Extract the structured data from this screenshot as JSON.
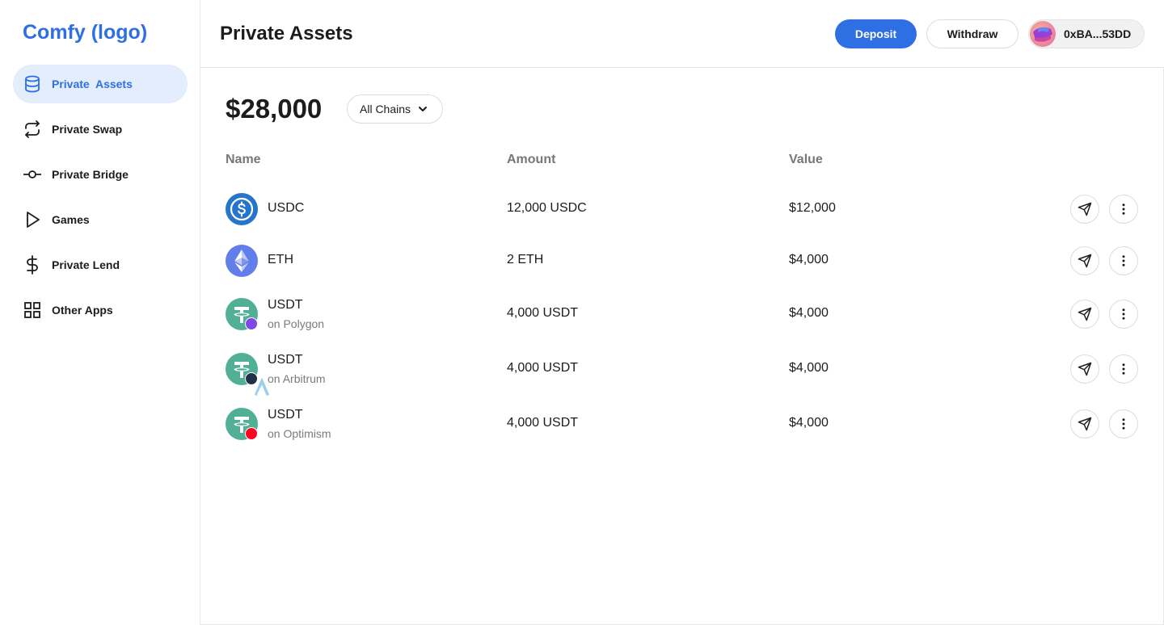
{
  "app": {
    "logo": "Comfy (logo)"
  },
  "sidebar": {
    "items": [
      {
        "label": "Private  Assets",
        "icon": "database-icon",
        "active": true
      },
      {
        "label": "Private Swap",
        "icon": "swap-arrows-icon",
        "active": false
      },
      {
        "label": "Private Bridge",
        "icon": "bridge-node-icon",
        "active": false
      },
      {
        "label": "Games",
        "icon": "play-icon",
        "active": false
      },
      {
        "label": "Private Lend",
        "icon": "dollar-icon",
        "active": false
      },
      {
        "label": "Other Apps",
        "icon": "grid-icon",
        "active": false
      }
    ]
  },
  "header": {
    "title": "Private Assets",
    "deposit_label": "Deposit",
    "withdraw_label": "Withdraw",
    "wallet_address": "0xBA...53DD"
  },
  "main": {
    "total_value": "$28,000",
    "chain_filter": "All Chains",
    "columns": {
      "name": "Name",
      "amount": "Amount",
      "value": "Value"
    },
    "assets": [
      {
        "name": "USDC",
        "chain": "",
        "amount": "12,000 USDC",
        "value": "$12,000",
        "icon": "usdc-icon"
      },
      {
        "name": "ETH",
        "chain": "",
        "amount": "2 ETH",
        "value": "$4,000",
        "icon": "eth-icon"
      },
      {
        "name": "USDT",
        "chain": "on Polygon",
        "amount": "4,000 USDT",
        "value": "$4,000",
        "icon": "usdt-icon",
        "chain_badge": "polygon-badge-icon"
      },
      {
        "name": "USDT",
        "chain": "on Arbitrum",
        "amount": "4,000 USDT",
        "value": "$4,000",
        "icon": "usdt-icon",
        "chain_badge": "arbitrum-badge-icon"
      },
      {
        "name": "USDT",
        "chain": "on Optimism",
        "amount": "4,000 USDT",
        "value": "$4,000",
        "icon": "usdt-icon",
        "chain_badge": "optimism-badge-icon"
      }
    ]
  },
  "colors": {
    "accent": "#2f6fe4",
    "active_bg": "#e3edfc",
    "usdc": "#2775ca",
    "eth": "#627eea",
    "usdt": "#50af95",
    "polygon": "#8247e5",
    "arbitrum": "#213147",
    "optimism": "#ff0420"
  }
}
